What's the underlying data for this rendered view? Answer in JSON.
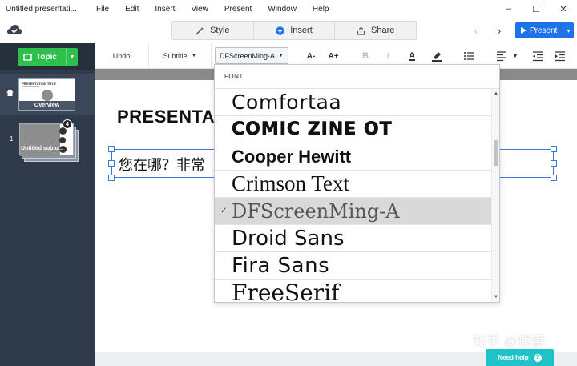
{
  "window": {
    "title": "Untitled presentati...",
    "menu": [
      "File",
      "Edit",
      "Insert",
      "View",
      "Present",
      "Window",
      "Help"
    ],
    "controls": {
      "minimize": "–",
      "maximize": "☐",
      "close": "✕"
    }
  },
  "toolbar": {
    "style_label": "Style",
    "insert_label": "Insert",
    "share_label": "Share",
    "prev": "‹",
    "next": "›",
    "present_label": "Present"
  },
  "sidebar": {
    "topic_label": "Topic",
    "slides": [
      {
        "caption": "Overview",
        "mini_title": "PRESENTATION TITLE"
      },
      {
        "number": "1",
        "caption": "Untitled subto...",
        "badge": "4"
      }
    ]
  },
  "ribbon": {
    "undo_label": "Undo",
    "subtitle_label": "Subtitle",
    "font_value": "DFScreenMing-A",
    "decrease_font": "A-",
    "increase_font": "A+",
    "bold": "B",
    "italic": "I",
    "text_color": "A"
  },
  "slide": {
    "heading": "PRESENTA",
    "body_text": "您在哪？非常"
  },
  "font_dropdown": {
    "header": "FONT",
    "fonts": [
      "Comfortaa",
      "COMIC ZINE OT",
      "Cooper Hewitt",
      "Crimson Text",
      "DFScreenMing-A",
      "Droid Sans",
      "Fira Sans",
      "FreeSerif"
    ],
    "selected": "DFScreenMing-A"
  },
  "watermark": "知乎 @螃蟹",
  "help": {
    "label": "Need help"
  },
  "colors": {
    "sidebar_bg": "#2f3a4a",
    "topic_green": "#2fbf4e",
    "present_blue": "#1e73e8",
    "selection_blue": "#3b7bdc",
    "help_teal": "#1fc3c5"
  }
}
